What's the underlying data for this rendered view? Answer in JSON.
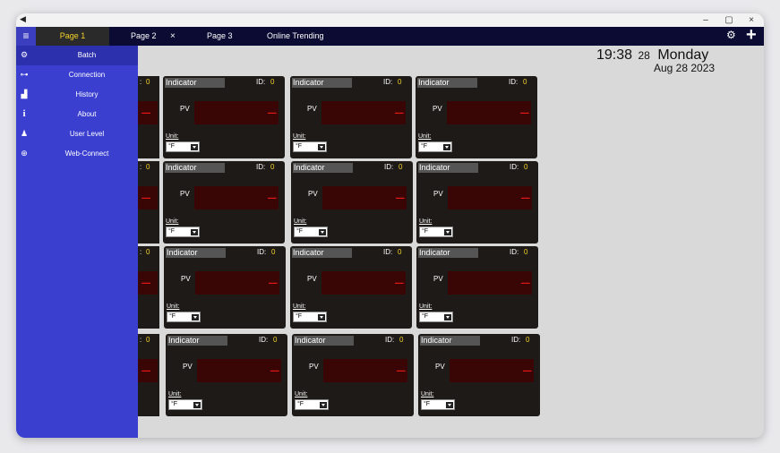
{
  "window": {
    "controls": {
      "minimize": "–",
      "maximize": "▢",
      "close": "×"
    }
  },
  "tabs": [
    {
      "label": "Page 1"
    },
    {
      "label": "Page 2",
      "close": "×"
    },
    {
      "label": "Page 3"
    },
    {
      "label": "Online Trending"
    }
  ],
  "toolbar": {
    "settings_icon": "gear-icon",
    "add_icon": "plus-icon",
    "add_label": "+"
  },
  "clock": {
    "time": "19:38",
    "day_num": "28",
    "day_name": "Monday",
    "date": "Aug 28 2023"
  },
  "sidebar": {
    "items": [
      {
        "label": "Batch",
        "icon": "gears-icon",
        "glyph": "⚙"
      },
      {
        "label": "Connection",
        "icon": "connection-icon",
        "glyph": "⊶"
      },
      {
        "label": "History",
        "icon": "bar-chart-icon",
        "glyph": "▟"
      },
      {
        "label": "About",
        "icon": "info-icon",
        "glyph": "i"
      },
      {
        "label": "User Level",
        "icon": "users-icon",
        "glyph": "♟"
      },
      {
        "label": "Web-Connect",
        "icon": "globe-icon",
        "glyph": "⊕"
      }
    ]
  },
  "indicator": {
    "title": "Indicator",
    "id_label": "ID:",
    "id_value": "0",
    "pv_label": "PV",
    "display_value": "----",
    "unit_label": "Unit:",
    "unit_value": "°F"
  },
  "colors": {
    "sidebar_bg": "#3b3fd0",
    "tabbar_bg": "#0b0b33",
    "active_tab_text": "#f5d22a",
    "card_bg": "#1d1a17",
    "display_bg": "#3a0605",
    "display_text": "#e01818",
    "id_value": "#f5d22a"
  }
}
